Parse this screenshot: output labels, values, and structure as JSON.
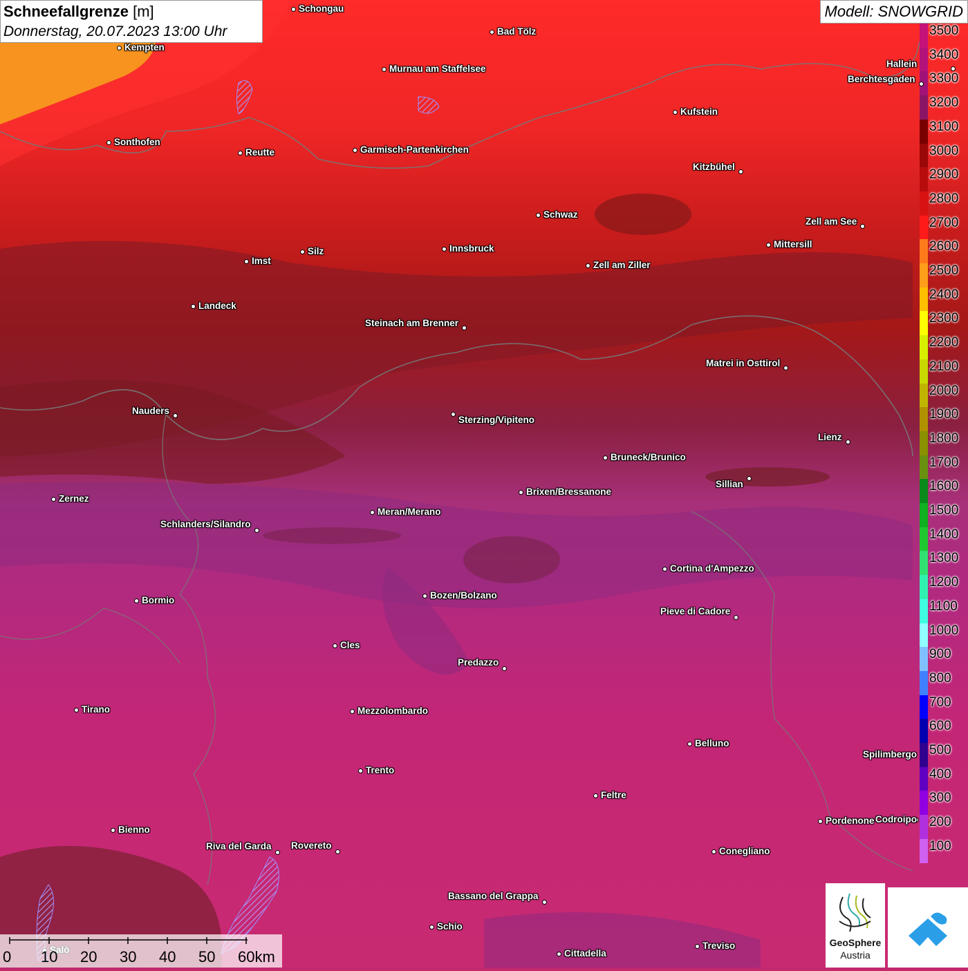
{
  "header": {
    "title_bold": "Schneefallgrenze",
    "title_unit": "[m]",
    "subtitle": "Donnerstag, 20.07.2023 13:00 Uhr"
  },
  "model": {
    "label": "Modell: SNOWGRID"
  },
  "legend": {
    "labels": [
      "3500",
      "3400",
      "3300",
      "3200",
      "3100",
      "3000",
      "2900",
      "2800",
      "2700",
      "2600",
      "2500",
      "2400",
      "2300",
      "2200",
      "2100",
      "2000",
      "1900",
      "1800",
      "1700",
      "1600",
      "1500",
      "1400",
      "1300",
      "1200",
      "1100",
      "1000",
      "900",
      "800",
      "700",
      "600",
      "500",
      "400",
      "300",
      "200",
      "100"
    ],
    "colors": [
      "#c4127a",
      "#b3127a",
      "#a11278",
      "#8a1566",
      "#7a0000",
      "#9a0808",
      "#b80c0c",
      "#d81212",
      "#ff1a1a",
      "#ff7a1a",
      "#ff9e1a",
      "#ffbf00",
      "#ffff00",
      "#d8f000",
      "#c8d800",
      "#c0b400",
      "#b09000",
      "#8a9000",
      "#6a9010",
      "#0a8a1a",
      "#10b020",
      "#20c830",
      "#30e070",
      "#30f0b0",
      "#40ffe0",
      "#90ffff",
      "#80c0ff",
      "#4080ff",
      "#0000ff",
      "#0000b0",
      "#300090",
      "#6000c0",
      "#9000e0",
      "#b030e0",
      "#d060f0"
    ]
  },
  "cities": [
    {
      "name": "Schongau"
    },
    {
      "name": "Bad Tölz"
    },
    {
      "name": "Kempten"
    },
    {
      "name": "Murnau am Staffelsee"
    },
    {
      "name": "Hallein"
    },
    {
      "name": "Berchtesgaden"
    },
    {
      "name": "Kufstein"
    },
    {
      "name": "Sonthofen"
    },
    {
      "name": "Reutte"
    },
    {
      "name": "Garmisch-Partenkirchen"
    },
    {
      "name": "Kitzbühel"
    },
    {
      "name": "Schwaz"
    },
    {
      "name": "Zell am See"
    },
    {
      "name": "Silz"
    },
    {
      "name": "Innsbruck"
    },
    {
      "name": "Mittersill"
    },
    {
      "name": "Imst"
    },
    {
      "name": "Zell am Ziller"
    },
    {
      "name": "Landeck"
    },
    {
      "name": "Steinach am Brenner"
    },
    {
      "name": "Matrei in Osttirol"
    },
    {
      "name": "Nauders"
    },
    {
      "name": "Sterzing/Vipiteno"
    },
    {
      "name": "Lienz"
    },
    {
      "name": "Bruneck/Brunico"
    },
    {
      "name": "Sillian"
    },
    {
      "name": "Brixen/Bressanone"
    },
    {
      "name": "Zernez"
    },
    {
      "name": "Meran/Merano"
    },
    {
      "name": "Schlanders/Silandro"
    },
    {
      "name": "Cortina d'Ampezzo"
    },
    {
      "name": "Bozen/Bolzano"
    },
    {
      "name": "Bormio"
    },
    {
      "name": "Pieve di Cadore"
    },
    {
      "name": "Cles"
    },
    {
      "name": "Predazzo"
    },
    {
      "name": "Tirano"
    },
    {
      "name": "Mezzolombardo"
    },
    {
      "name": "Belluno"
    },
    {
      "name": "Spilimbergo"
    },
    {
      "name": "Trento"
    },
    {
      "name": "Feltre"
    },
    {
      "name": "Pordenone"
    },
    {
      "name": "Codroipo"
    },
    {
      "name": "Bienno"
    },
    {
      "name": "Riva del Garda"
    },
    {
      "name": "Rovereto"
    },
    {
      "name": "Conegliano"
    },
    {
      "name": "Bassano del Grappa"
    },
    {
      "name": "Schio"
    },
    {
      "name": "Treviso"
    },
    {
      "name": "Cittadella"
    },
    {
      "name": "Salò"
    }
  ],
  "scale": {
    "labels": [
      "0",
      "10",
      "20",
      "30",
      "40",
      "50",
      "60km"
    ]
  },
  "logo": {
    "line1": "GeoSphere",
    "line2": "Austria"
  }
}
